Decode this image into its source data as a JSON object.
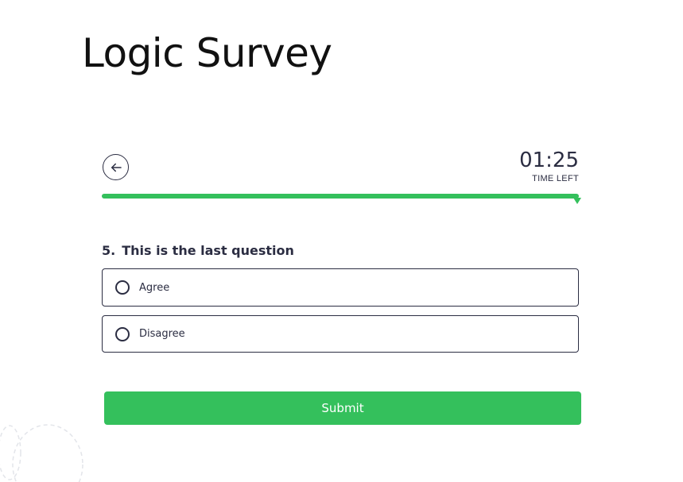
{
  "page": {
    "title": "Logic Survey"
  },
  "nav": {
    "back_icon": "arrow-left-icon"
  },
  "timer": {
    "value": "01:25",
    "label": "TIME LEFT"
  },
  "progress": {
    "fraction": 1.0,
    "color": "#34c05c"
  },
  "question": {
    "number": "5.",
    "text": "This is the last question",
    "options": [
      {
        "label": "Agree",
        "selected": false
      },
      {
        "label": "Disagree",
        "selected": false
      }
    ]
  },
  "actions": {
    "submit_label": "Submit"
  },
  "colors": {
    "accent": "#34c05c",
    "text": "#2b2d42"
  }
}
